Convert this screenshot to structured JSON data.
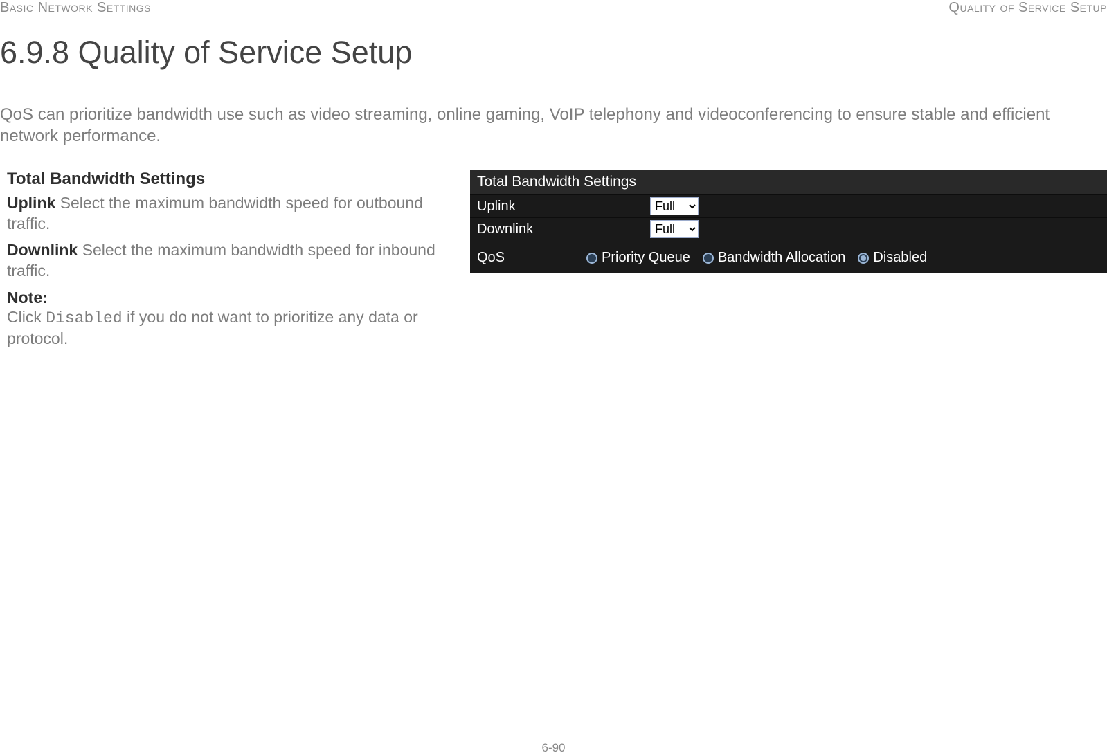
{
  "header": {
    "left": "Basic Network Settings",
    "right": "Quality of Service Setup"
  },
  "title": "6.9.8 Quality of Service Setup",
  "intro": "QoS can prioritize bandwidth use such as video streaming, online gaming, VoIP telephony and videoconferencing to ensure stable and efficient network performance.",
  "left": {
    "section_heading": "Total Bandwidth Settings",
    "uplink_term": "Uplink",
    "uplink_desc": "  Select the maximum bandwidth speed for outbound traffic.",
    "downlink_term": "Downlink",
    "downlink_desc": "  Select the maximum bandwidth speed for inbound traffic.",
    "note_label": "Note:",
    "note_pre": "Click ",
    "note_code": "Disabled",
    "note_post": " if you do not want to prioritize any data or protocol."
  },
  "panel": {
    "title": "Total Bandwidth Settings",
    "uplink_label": "Uplink",
    "uplink_value": "Full",
    "downlink_label": "Downlink",
    "downlink_value": "Full",
    "qos_label": "QoS",
    "qos_options": {
      "priority": "Priority Queue",
      "bandwidth": "Bandwidth Allocation",
      "disabled": "Disabled"
    },
    "qos_selected": "disabled"
  },
  "footer": "6-90"
}
